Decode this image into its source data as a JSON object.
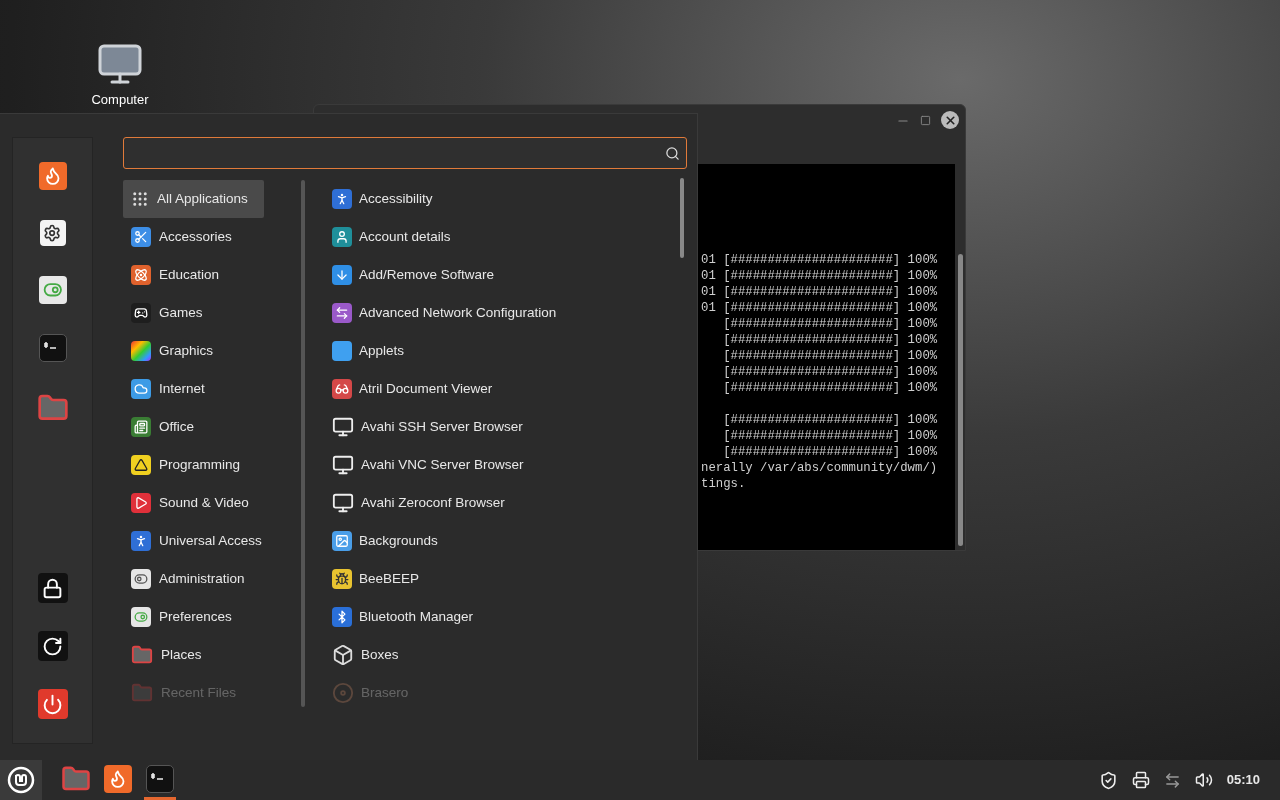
{
  "desktop": {
    "icons": [
      {
        "label": "Computer"
      }
    ]
  },
  "terminal": {
    "blocks": [
      [
        "01 [######################] 100%",
        "01 [######################] 100%",
        "01 [######################] 100%",
        "01 [######################] 100%",
        "   [######################] 100%",
        "   [######################] 100%",
        "   [######################] 100%",
        "   [######################] 100%",
        "   [######################] 100%"
      ],
      [
        "   [######################] 100%",
        "   [######################] 100%",
        "   [######################] 100%",
        "nerally /var/abs/community/dwm/)",
        "tings."
      ]
    ]
  },
  "menu": {
    "categories": [
      {
        "label": "All Applications",
        "selected": true,
        "dimmed": false
      },
      {
        "label": "Accessories",
        "selected": false,
        "dimmed": false
      },
      {
        "label": "Education",
        "selected": false,
        "dimmed": false
      },
      {
        "label": "Games",
        "selected": false,
        "dimmed": false
      },
      {
        "label": "Graphics",
        "selected": false,
        "dimmed": false
      },
      {
        "label": "Internet",
        "selected": false,
        "dimmed": false
      },
      {
        "label": "Office",
        "selected": false,
        "dimmed": false
      },
      {
        "label": "Programming",
        "selected": false,
        "dimmed": false
      },
      {
        "label": "Sound & Video",
        "selected": false,
        "dimmed": false
      },
      {
        "label": "Universal Access",
        "selected": false,
        "dimmed": false
      },
      {
        "label": "Administration",
        "selected": false,
        "dimmed": false
      },
      {
        "label": "Preferences",
        "selected": false,
        "dimmed": false
      },
      {
        "label": "Places",
        "selected": false,
        "dimmed": false
      },
      {
        "label": "Recent Files",
        "selected": false,
        "dimmed": true
      }
    ],
    "apps": [
      {
        "label": "Accessibility",
        "dimmed": false
      },
      {
        "label": "Account details",
        "dimmed": false
      },
      {
        "label": "Add/Remove Software",
        "dimmed": false
      },
      {
        "label": "Advanced Network Configuration",
        "dimmed": false
      },
      {
        "label": "Applets",
        "dimmed": false
      },
      {
        "label": "Atril Document Viewer",
        "dimmed": false
      },
      {
        "label": "Avahi SSH Server Browser",
        "dimmed": false
      },
      {
        "label": "Avahi VNC Server Browser",
        "dimmed": false
      },
      {
        "label": "Avahi Zeroconf Browser",
        "dimmed": false
      },
      {
        "label": "Backgrounds",
        "dimmed": false
      },
      {
        "label": "BeeBEEP",
        "dimmed": false
      },
      {
        "label": "Bluetooth Manager",
        "dimmed": false
      },
      {
        "label": "Boxes",
        "dimmed": false
      },
      {
        "label": "Brasero",
        "dimmed": true
      }
    ]
  },
  "taskbar": {
    "launchers": [
      {
        "running": false
      },
      {
        "running": false
      },
      {
        "running": true
      }
    ],
    "clock": "05:10"
  }
}
